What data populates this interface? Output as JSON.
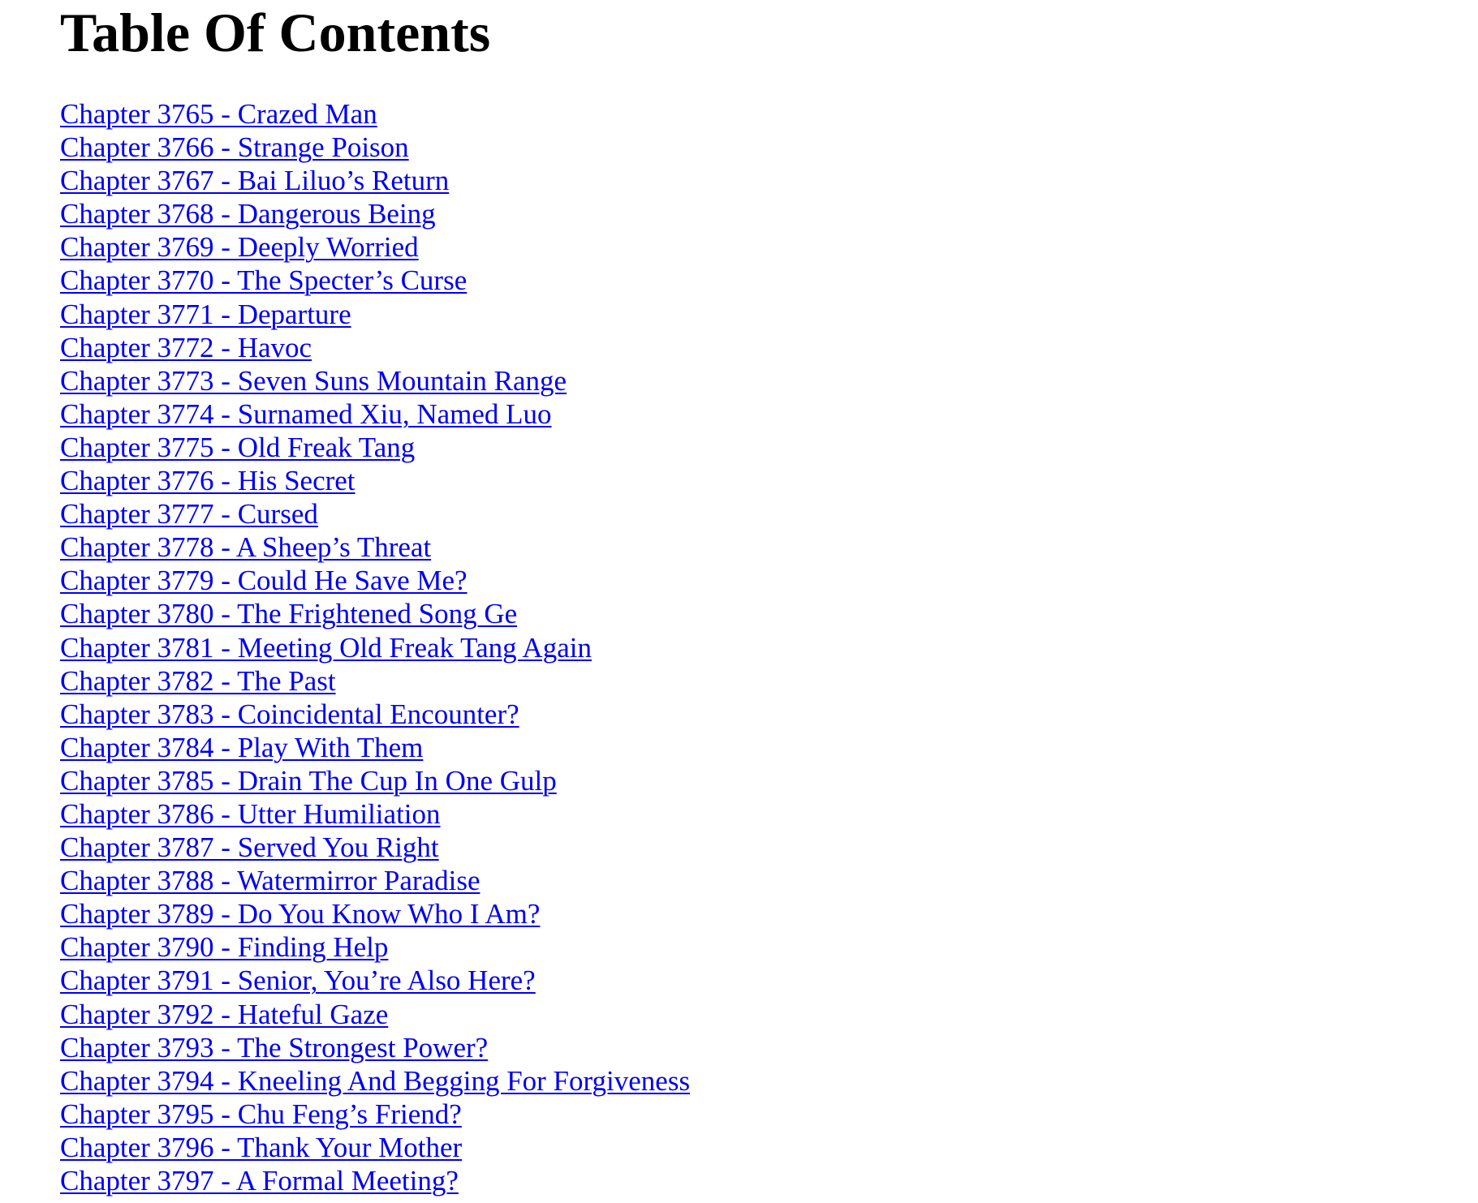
{
  "document": {
    "title": "Table Of Contents",
    "link_color": "#0000ee",
    "chapters": [
      "Chapter 3765 - Crazed Man",
      "Chapter 3766 - Strange Poison",
      "Chapter 3767 - Bai Liluo’s Return",
      "Chapter 3768 - Dangerous Being",
      "Chapter 3769 - Deeply Worried",
      "Chapter 3770 - The Specter’s Curse",
      "Chapter 3771 - Departure",
      "Chapter 3772 - Havoc",
      "Chapter 3773 - Seven Suns Mountain Range",
      "Chapter 3774 - Surnamed Xiu, Named Luo",
      "Chapter 3775 - Old Freak Tang",
      "Chapter 3776 - His Secret",
      "Chapter 3777 - Cursed",
      "Chapter 3778 - A Sheep’s Threat",
      "Chapter 3779 - Could He Save Me?",
      "Chapter 3780 - The Frightened Song Ge",
      "Chapter 3781 - Meeting Old Freak Tang Again",
      "Chapter 3782 - The Past",
      "Chapter 3783 - Coincidental Encounter?",
      "Chapter 3784 - Play With Them",
      "Chapter 3785 - Drain The Cup In One Gulp",
      "Chapter 3786 - Utter Humiliation",
      "Chapter 3787 - Served You Right",
      "Chapter 3788 - Watermirror Paradise",
      "Chapter 3789 - Do You Know Who I Am?",
      "Chapter 3790 - Finding Help",
      "Chapter 3791 - Senior, You’re Also Here?",
      "Chapter 3792 - Hateful Gaze",
      "Chapter 3793 - The Strongest Power?",
      "Chapter 3794 - Kneeling And Begging For Forgiveness",
      "Chapter 3795 - Chu Feng’s Friend?",
      "Chapter 3796 - Thank Your Mother",
      "Chapter 3797 - A Formal Meeting?"
    ]
  }
}
